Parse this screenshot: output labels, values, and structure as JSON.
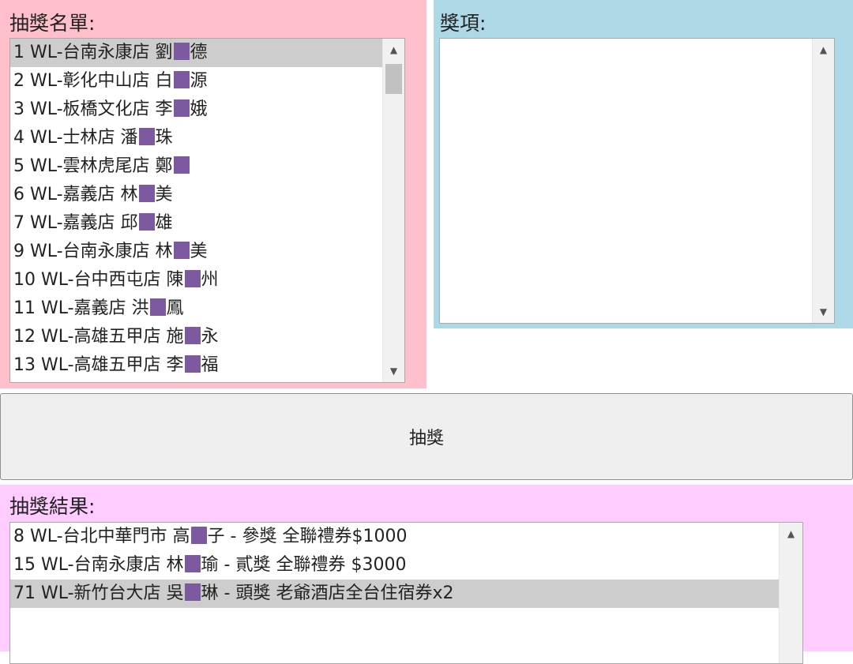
{
  "list_panel": {
    "label": "抽獎名單:",
    "entries": [
      {
        "pre": "1 WL-台南永康店 劉",
        "post": "德"
      },
      {
        "pre": "2 WL-彰化中山店 白",
        "post": "源"
      },
      {
        "pre": "3 WL-板橋文化店 李",
        "post": "娥"
      },
      {
        "pre": "4 WL-士林店 潘",
        "post": "珠"
      },
      {
        "pre": "5 WL-雲林虎尾店 鄭",
        "post": ""
      },
      {
        "pre": "6 WL-嘉義店 林",
        "post": "美"
      },
      {
        "pre": "7 WL-嘉義店 邱",
        "post": "雄"
      },
      {
        "pre": "9 WL-台南永康店 林",
        "post": "美"
      },
      {
        "pre": "10 WL-台中西屯店 陳",
        "post": "州"
      },
      {
        "pre": "11 WL-嘉義店 洪",
        "post": "鳳"
      },
      {
        "pre": "12 WL-高雄五甲店 施",
        "post": "永"
      },
      {
        "pre": "13 WL-高雄五甲店 李",
        "post": "福"
      }
    ]
  },
  "prize_panel": {
    "label": "獎項:"
  },
  "draw_button": {
    "label": "抽獎"
  },
  "result_panel": {
    "label": "抽獎結果:",
    "entries": [
      {
        "pre": "8 WL-台北中華門市 高",
        "post": "子 - 參獎 全聯禮券$1000"
      },
      {
        "pre": "15 WL-台南永康店 林",
        "post": "瑜 - 貳獎 全聯禮券 $3000"
      },
      {
        "pre": "71 WL-新竹台大店 吳",
        "post": "琳 - 頭獎 老爺酒店全台住宿券x2"
      }
    ]
  },
  "colors": {
    "list_panel_bg": "#ffc0cb",
    "prize_panel_bg": "#add8e6",
    "result_panel_bg": "#ffccff",
    "selection": "#cdcdcd",
    "redaction": "#7d5aa0"
  },
  "icons": {
    "scroll_up": "triangle-up-icon",
    "scroll_down": "triangle-down-icon"
  }
}
